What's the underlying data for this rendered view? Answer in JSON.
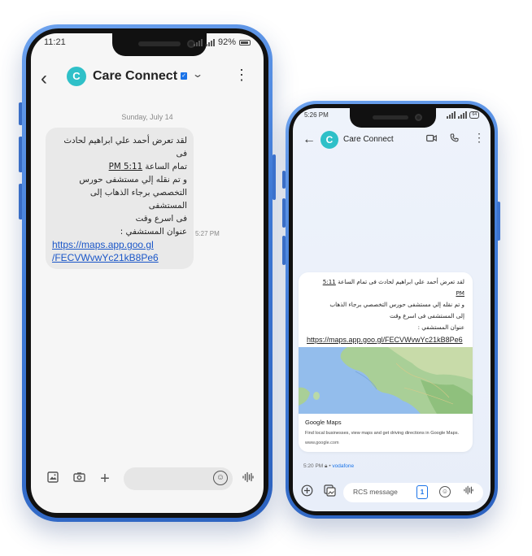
{
  "phone1": {
    "status": {
      "time": "11:21",
      "battery": "92%"
    },
    "header": {
      "contact": "Care Connect",
      "avatar_letter": "C",
      "back_icon": "back-arrow-icon",
      "menu_icon": "more-vert-icon"
    },
    "date_label": "Sunday, July 14",
    "message": {
      "line1": "لقد تعرض أحمد علي ابراهيم لحادث فى",
      "line2_prefix": "تمام الساعة ",
      "line2_time": "5:11 PM",
      "line3": "و تم نقله إلي مستشفى حورس",
      "line4": "التخصصي برجاء الذهاب إلى المستشفى",
      "line5": "فى اسرع وقت",
      "line6": "عنوان المستشفي :",
      "link_part1": "https://maps.app.goo.gl",
      "link_part2": "/FECVWvwYc21kB8Pe6",
      "timestamp": "5:27 PM"
    },
    "composer": {
      "gallery_icon": "image-icon",
      "camera_icon": "camera-icon",
      "add_icon": "plus-icon",
      "emoji_icon": "emoji-icon",
      "voice_icon": "voice-wave-icon"
    }
  },
  "phone2": {
    "status": {
      "time": "5:26 PM",
      "battery": "64"
    },
    "header": {
      "contact": "Care Connect",
      "avatar_letter": "C"
    },
    "message": {
      "line1_prefix": "لقد تعرض أحمد علي ابراهيم لحادث فى تمام الساعة ",
      "time_num": "5:11",
      "time_pm": "PM",
      "line3": "و تم نقله إلي مستشفى حورس التخصصي برجاء الذهاب",
      "line4": "إلى المستشفى فى اسرع وقت",
      "line5": "عنوان المستشفي :",
      "link": "https://maps.app.goo.gl/FECVWvwYc21kB8Pe6"
    },
    "preview": {
      "title": "Google Maps",
      "description": "Find local businesses, view maps and get driving directions in Google Maps.",
      "site": "www.google.com"
    },
    "meta": {
      "time": "5:20 PM",
      "separator": "•",
      "carrier": "vodafone"
    },
    "composer": {
      "placeholder": "RCS message",
      "sim_label": "1"
    }
  }
}
